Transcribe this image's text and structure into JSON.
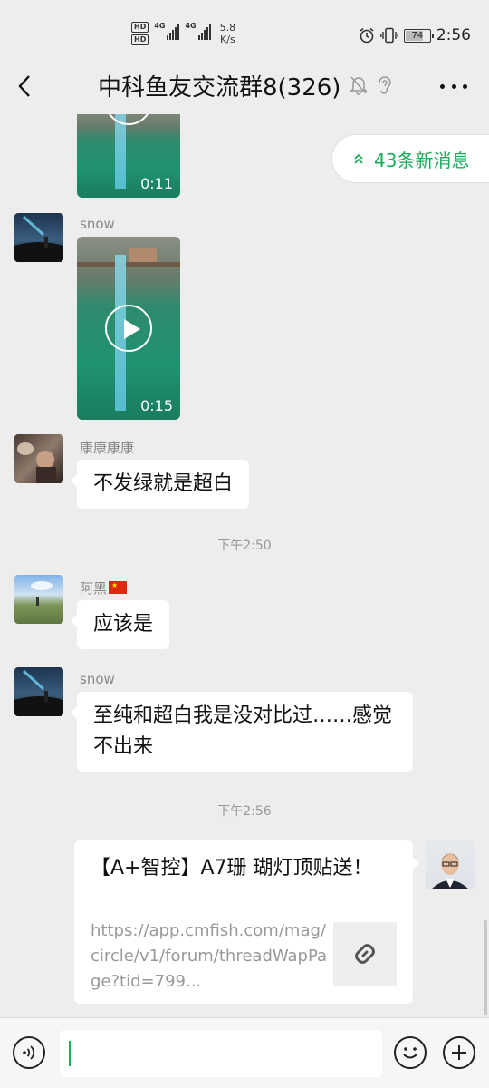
{
  "status_bar": {
    "hd1": "HD",
    "hd2": "HD",
    "net1": "4G",
    "net2": "4G",
    "speed_value": "5.8",
    "speed_unit": "K/s",
    "battery": "74",
    "battery_level": 0.74,
    "time": "2:56",
    "icons": [
      "alarm-icon",
      "vibrate-icon",
      "battery-icon"
    ]
  },
  "header": {
    "title": "中科鱼友交流群8(326)",
    "icons": [
      "back-arrow-icon",
      "mute-bell-icon",
      "ear-icon",
      "more-icon"
    ]
  },
  "new_messages": {
    "label": "43条新消息",
    "icon": "double-chevron-up-icon",
    "color": "#1aad5b"
  },
  "messages": [
    {
      "type": "video",
      "duration": "0:11"
    },
    {
      "type": "video",
      "sender": "snow",
      "duration": "0:15"
    },
    {
      "type": "text",
      "sender": "康康康康",
      "text": "不发绿就是超白"
    },
    {
      "type": "timestamp",
      "text": "下午2:50"
    },
    {
      "type": "text",
      "sender": "阿黑",
      "flag": "🇨🇳",
      "text": "应该是"
    },
    {
      "type": "text",
      "sender": "snow",
      "text": "至纯和超白我是没对比过……感觉不出来"
    },
    {
      "type": "timestamp",
      "text": "下午2:56"
    },
    {
      "type": "link",
      "self": true,
      "title": "【A+智控】A7珊 瑚灯顶贴送！",
      "url": "https://app.cmfish.com/mag/circle/v1/forum/threadWapPage?tid=799...",
      "icon": "link-icon"
    }
  ],
  "input_bar": {
    "value": "",
    "icons": [
      "voice-icon",
      "emoji-icon",
      "plus-icon"
    ]
  }
}
